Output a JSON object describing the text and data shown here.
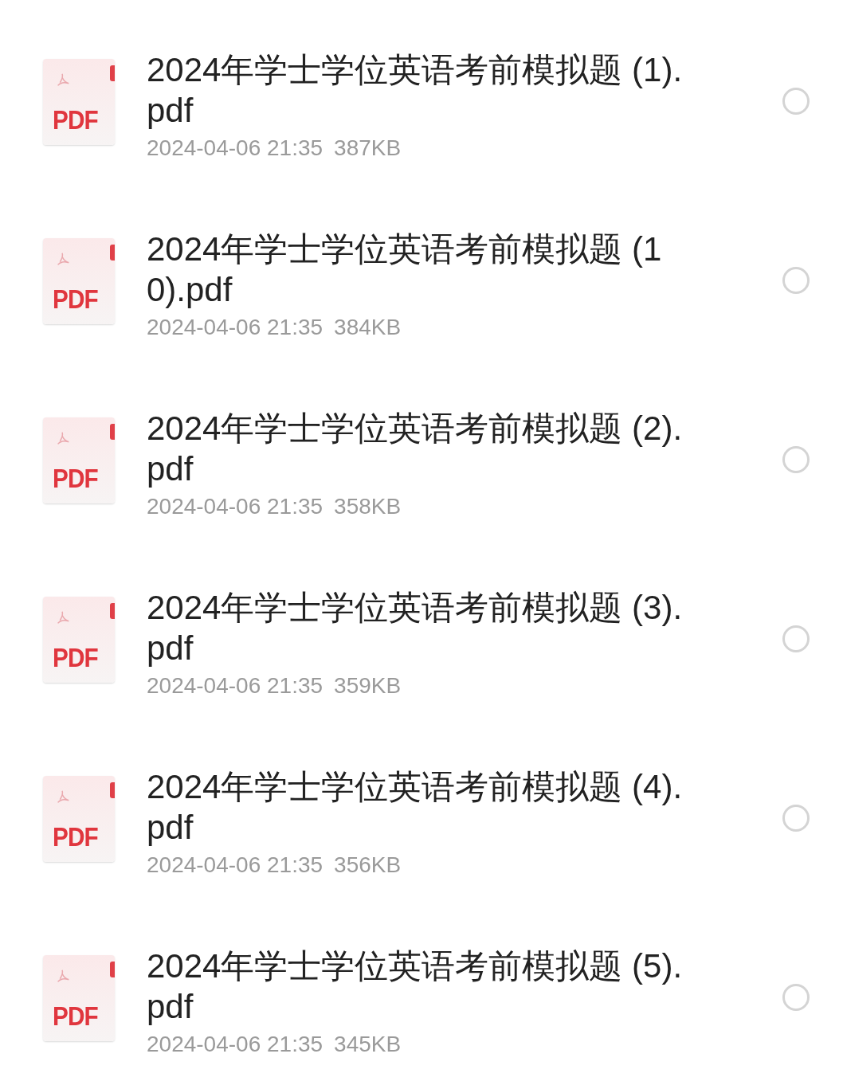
{
  "files": [
    {
      "badge": "PDF",
      "name": "2024年学士学位英语考前模拟题 (1).pdf",
      "date": "2024-04-06 21:35",
      "size": "387KB",
      "selected": false
    },
    {
      "badge": "PDF",
      "name": "2024年学士学位英语考前模拟题 (10).pdf",
      "date": "2024-04-06 21:35",
      "size": "384KB",
      "selected": false
    },
    {
      "badge": "PDF",
      "name": "2024年学士学位英语考前模拟题 (2).pdf",
      "date": "2024-04-06 21:35",
      "size": "358KB",
      "selected": false
    },
    {
      "badge": "PDF",
      "name": "2024年学士学位英语考前模拟题 (3).pdf",
      "date": "2024-04-06 21:35",
      "size": "359KB",
      "selected": false
    },
    {
      "badge": "PDF",
      "name": "2024年学士学位英语考前模拟题 (4).pdf",
      "date": "2024-04-06 21:35",
      "size": "356KB",
      "selected": false
    },
    {
      "badge": "PDF",
      "name": "2024年学士学位英语考前模拟题 (5).pdf",
      "date": "2024-04-06 21:35",
      "size": "345KB",
      "selected": false
    }
  ]
}
